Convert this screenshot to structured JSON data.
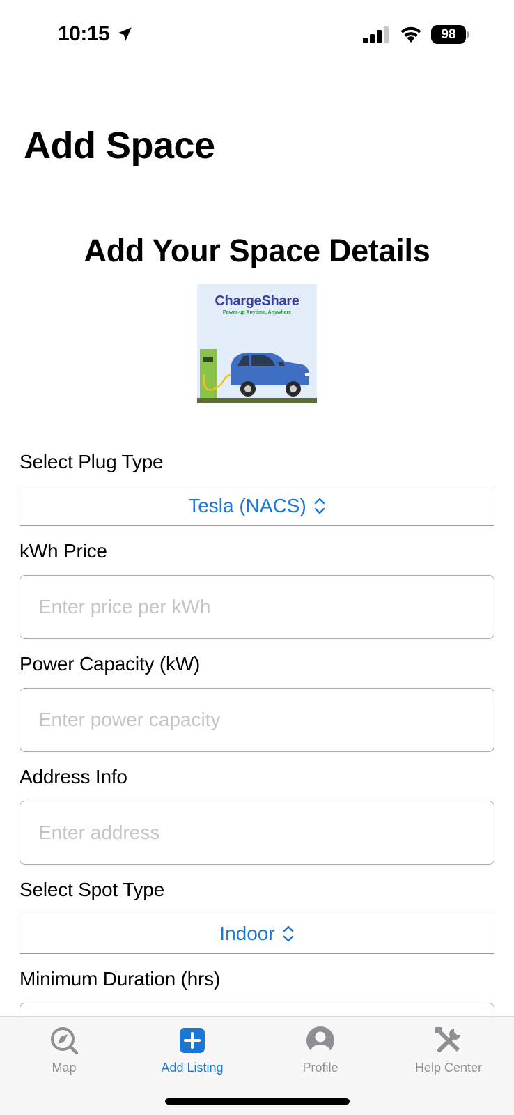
{
  "status_bar": {
    "time": "10:15",
    "battery": "98"
  },
  "page": {
    "title": "Add Space",
    "heading": "Add Your Space Details"
  },
  "logo": {
    "name": "ChargeShare",
    "tagline": "Power-up Anytime, Anywhere"
  },
  "form": {
    "plug_type": {
      "label": "Select Plug Type",
      "value": "Tesla (NACS)"
    },
    "kwh_price": {
      "label": "kWh Price",
      "placeholder": "Enter price per kWh"
    },
    "power_capacity": {
      "label": "Power Capacity (kW)",
      "placeholder": "Enter power capacity"
    },
    "address": {
      "label": "Address Info",
      "placeholder": "Enter address"
    },
    "spot_type": {
      "label": "Select Spot Type",
      "value": "Indoor"
    },
    "min_duration": {
      "label": "Minimum Duration (hrs)"
    }
  },
  "tab_bar": {
    "active": "Add Listing",
    "accent_color": "#1a78d4",
    "tabs": [
      {
        "label": "Map",
        "icon": "map-compass-icon"
      },
      {
        "label": "Add Listing",
        "icon": "plus-square-icon"
      },
      {
        "label": "Profile",
        "icon": "person-circle-icon"
      },
      {
        "label": "Help Center",
        "icon": "tools-icon"
      }
    ]
  }
}
